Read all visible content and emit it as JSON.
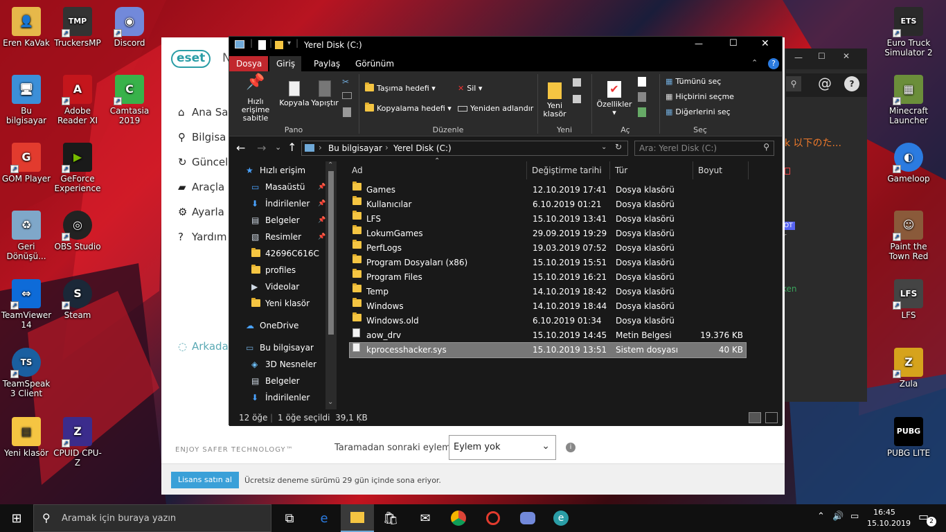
{
  "desktop": {
    "left_icons": [
      {
        "label": "Eren KaVak",
        "color": "#e6b84a",
        "glyph": "👤"
      },
      {
        "label": "TruckersMP",
        "color": "#333333",
        "glyph": "TMP"
      },
      {
        "label": "Discord",
        "color": "#7289da",
        "glyph": "◉"
      },
      {
        "label": "Bu bilgisayar",
        "color": "#3c8fd8",
        "glyph": "🖥"
      },
      {
        "label": "Adobe Reader XI",
        "color": "#c4161c",
        "glyph": "A"
      },
      {
        "label": "Camtasia 2019",
        "color": "#38b24a",
        "glyph": "C"
      },
      {
        "label": "GOM Player",
        "color": "#e23b2e",
        "glyph": "G"
      },
      {
        "label": "GeForce Experience",
        "color": "#76b900",
        "glyph": "▶"
      },
      {
        "label": "Geri Dönüşü...",
        "color": "#7fa7c9",
        "glyph": "♻"
      },
      {
        "label": "OBS Studio",
        "color": "#222222",
        "glyph": "◎"
      },
      {
        "label": "TeamViewer 14",
        "color": "#0e6bd8",
        "glyph": "⇔"
      },
      {
        "label": "Steam",
        "color": "#1b2838",
        "glyph": "S"
      },
      {
        "label": "TeamSpeak 3 Client",
        "color": "#1a5fa0",
        "glyph": "TS"
      },
      {
        "label": "Yeni klasör",
        "color": "#f5c542",
        "glyph": "▤"
      },
      {
        "label": "CPUID CPU-Z",
        "color": "#3b2c8c",
        "glyph": "Z"
      }
    ],
    "right_icons": [
      {
        "label": "Euro Truck Simulator 2",
        "color": "#2a2a2a",
        "glyph": "ETS"
      },
      {
        "label": "Minecraft Launcher",
        "color": "#6b8e3a",
        "glyph": "▦"
      },
      {
        "label": "Gameloop",
        "color": "#2b7be0",
        "glyph": "◐"
      },
      {
        "label": "Paint the Town Red",
        "color": "#8a5a3a",
        "glyph": "☺"
      },
      {
        "label": "LFS",
        "color": "#444444",
        "glyph": "LFS"
      },
      {
        "label": "Zula",
        "color": "#d6a31c",
        "glyph": "Z"
      },
      {
        "label": "PUBG LITE",
        "color": "#000000",
        "glyph": "PUBG"
      }
    ]
  },
  "eset": {
    "logo": "eset",
    "logo_suffix": "N",
    "menu": [
      {
        "label": "Ana Sa",
        "icon": "⌂"
      },
      {
        "label": "Bilgisa",
        "icon": "⚲"
      },
      {
        "label": "Güncel",
        "icon": "↻"
      },
      {
        "label": "Araçla",
        "icon": "▰"
      },
      {
        "label": "Ayarla",
        "icon": "⚙"
      },
      {
        "label": "Yardım",
        "icon": "?"
      },
      {
        "label": "Arkada",
        "icon": "◌"
      }
    ],
    "tagline": "ENJOY SAFER TECHNOLOGY™",
    "after_scan_label": "Taramadan sonraki eylem",
    "after_scan_value": "Eylem yok",
    "buy_button": "Lisans satın al",
    "trial_text": "Ücretsiz deneme sürümü 29 gün içinde sona eriyor."
  },
  "darkwin": {
    "text_fragment": "k 以下のた...",
    "badge": "OT",
    "small_r": "r",
    "green_fragment": "ken"
  },
  "explorer": {
    "title": "Yerel Disk (C:)",
    "tabs": [
      "Dosya",
      "Giriş",
      "Paylaş",
      "Görünüm"
    ],
    "ribbon": {
      "pin": "Hızlı erişime sabitle",
      "copy": "Kopyala",
      "paste": "Yapıştır",
      "move_to": "Taşıma hedefi",
      "copy_to": "Kopyalama hedefi",
      "delete": "Sil",
      "rename": "Yeniden adlandır",
      "new_folder": "Yeni klasör",
      "properties": "Özellikler",
      "select_all": "Tümünü seç",
      "select_none": "Hiçbirini seçme",
      "invert": "Diğerlerini seç",
      "groups": [
        "Pano",
        "Düzenle",
        "Yeni",
        "Aç",
        "Seç"
      ]
    },
    "breadcrumb": [
      "Bu bilgisayar",
      "Yerel Disk (C:)"
    ],
    "search_placeholder": "Ara: Yerel Disk (C:)",
    "nav": [
      {
        "label": "Hızlı erişim",
        "type": "star",
        "indent": 0,
        "pin": false
      },
      {
        "label": "Masaüstü",
        "type": "desktop",
        "indent": 1,
        "pin": true
      },
      {
        "label": "İndirilenler",
        "type": "down",
        "indent": 1,
        "pin": true
      },
      {
        "label": "Belgeler",
        "type": "doc",
        "indent": 1,
        "pin": true
      },
      {
        "label": "Resimler",
        "type": "pic",
        "indent": 1,
        "pin": true
      },
      {
        "label": "42696C616C",
        "type": "folder",
        "indent": 1,
        "pin": false
      },
      {
        "label": "profiles",
        "type": "folder",
        "indent": 1,
        "pin": false
      },
      {
        "label": "Videolar",
        "type": "video",
        "indent": 1,
        "pin": false
      },
      {
        "label": "Yeni klasör",
        "type": "folder",
        "indent": 1,
        "pin": false
      },
      {
        "label": "OneDrive",
        "type": "cloud",
        "indent": 0,
        "pin": false
      },
      {
        "label": "Bu bilgisayar",
        "type": "pc",
        "indent": 0,
        "pin": false
      },
      {
        "label": "3D Nesneler",
        "type": "cube",
        "indent": 1,
        "pin": false
      },
      {
        "label": "Belgeler",
        "type": "doc",
        "indent": 1,
        "pin": false
      },
      {
        "label": "İndirilenler",
        "type": "down",
        "indent": 1,
        "pin": false
      }
    ],
    "columns": [
      "Ad",
      "Değiştirme tarihi",
      "Tür",
      "Boyut"
    ],
    "files": [
      {
        "name": "Games",
        "date": "12.10.2019 17:41",
        "type": "Dosya klasörü",
        "size": "",
        "kind": "folder"
      },
      {
        "name": "Kullanıcılar",
        "date": "6.10.2019 01:21",
        "type": "Dosya klasörü",
        "size": "",
        "kind": "folder"
      },
      {
        "name": "LFS",
        "date": "15.10.2019 13:41",
        "type": "Dosya klasörü",
        "size": "",
        "kind": "folder"
      },
      {
        "name": "LokumGames",
        "date": "29.09.2019 19:29",
        "type": "Dosya klasörü",
        "size": "",
        "kind": "folder"
      },
      {
        "name": "PerfLogs",
        "date": "19.03.2019 07:52",
        "type": "Dosya klasörü",
        "size": "",
        "kind": "folder"
      },
      {
        "name": "Program Dosyaları (x86)",
        "date": "15.10.2019 15:51",
        "type": "Dosya klasörü",
        "size": "",
        "kind": "folder"
      },
      {
        "name": "Program Files",
        "date": "15.10.2019 16:21",
        "type": "Dosya klasörü",
        "size": "",
        "kind": "folder"
      },
      {
        "name": "Temp",
        "date": "14.10.2019 18:42",
        "type": "Dosya klasörü",
        "size": "",
        "kind": "folder"
      },
      {
        "name": "Windows",
        "date": "14.10.2019 18:44",
        "type": "Dosya klasörü",
        "size": "",
        "kind": "folder"
      },
      {
        "name": "Windows.old",
        "date": "6.10.2019 01:34",
        "type": "Dosya klasörü",
        "size": "",
        "kind": "folder"
      },
      {
        "name": "aow_drv",
        "date": "15.10.2019 14:45",
        "type": "Metin Belgesi",
        "size": "19.376 KB",
        "kind": "file"
      },
      {
        "name": "kprocesshacker.sys",
        "date": "15.10.2019 13:51",
        "type": "Sistem dosyası",
        "size": "40 KB",
        "kind": "file",
        "selected": true
      }
    ],
    "status_count": "12 öğe",
    "status_selected": "1 öğe seçildi  39,1 KB"
  },
  "taskbar": {
    "search_placeholder": "Aramak için buraya yazın",
    "time": "16:45",
    "date": "15.10.2019",
    "notifications": "2"
  }
}
